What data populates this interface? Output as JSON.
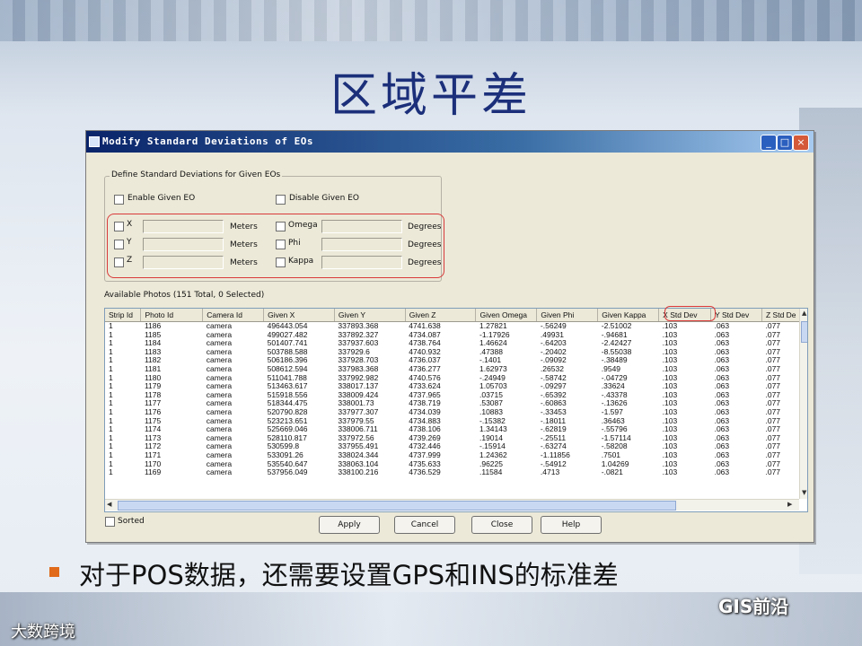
{
  "slide": {
    "title": "区域平差",
    "bullet": "对于POS数据，还需要设置GPS和INS的标准差",
    "watermark_right": "GIS前沿",
    "watermark_left": "大数跨境"
  },
  "dialog": {
    "title": "Modify Standard Deviations of EOs",
    "group_label": "Define Standard Deviations for Given EOs",
    "enable_label": "Enable Given EO",
    "disable_label": "Disable Given EO",
    "pos_fields": [
      {
        "label": "X",
        "unit": "Meters"
      },
      {
        "label": "Y",
        "unit": "Meters"
      },
      {
        "label": "Z",
        "unit": "Meters"
      }
    ],
    "att_fields": [
      {
        "label": "Omega",
        "unit": "Degrees"
      },
      {
        "label": "Phi",
        "unit": "Degrees"
      },
      {
        "label": "Kappa",
        "unit": "Degrees"
      }
    ],
    "available_label": "Available Photos (151 Total, 0 Selected)",
    "sorted_label": "Sorted",
    "buttons": {
      "apply": "Apply",
      "cancel": "Cancel",
      "close": "Close",
      "help": "Help"
    },
    "highlight_color": "#d83a3a",
    "table": {
      "columns": [
        "Strip Id",
        "Photo Id",
        "Camera Id",
        "Given X",
        "Given Y",
        "Given Z",
        "Given Omega",
        "Given Phi",
        "Given Kappa",
        "X Std Dev",
        "Y Std Dev",
        "Z Std De"
      ],
      "rows": [
        [
          "1",
          "1186",
          "camera",
          "496443.054",
          "337893.368",
          "4741.638",
          "1.27821",
          "-.56249",
          "-2.51002",
          ".103",
          ".063",
          ".077"
        ],
        [
          "1",
          "1185",
          "camera",
          "499027.482",
          "337892.327",
          "4734.087",
          "-1.17926",
          ".49931",
          "-.94681",
          ".103",
          ".063",
          ".077"
        ],
        [
          "1",
          "1184",
          "camera",
          "501407.741",
          "337937.603",
          "4738.764",
          "1.46624",
          "-.64203",
          "-2.42427",
          ".103",
          ".063",
          ".077"
        ],
        [
          "1",
          "1183",
          "camera",
          "503788.588",
          "337929.6",
          "4740.932",
          ".47388",
          "-.20402",
          "-8.55038",
          ".103",
          ".063",
          ".077"
        ],
        [
          "1",
          "1182",
          "camera",
          "506186.396",
          "337928.703",
          "4736.037",
          "-.1401",
          "-.09092",
          "-.38489",
          ".103",
          ".063",
          ".077"
        ],
        [
          "1",
          "1181",
          "camera",
          "508612.594",
          "337983.368",
          "4736.277",
          "1.62973",
          ".26532",
          ".9549",
          ".103",
          ".063",
          ".077"
        ],
        [
          "1",
          "1180",
          "camera",
          "511041.788",
          "337992.982",
          "4740.576",
          "-.24949",
          "-.58742",
          "-.04729",
          ".103",
          ".063",
          ".077"
        ],
        [
          "1",
          "1179",
          "camera",
          "513463.617",
          "338017.137",
          "4733.624",
          "1.05703",
          "-.09297",
          ".33624",
          ".103",
          ".063",
          ".077"
        ],
        [
          "1",
          "1178",
          "camera",
          "515918.556",
          "338009.424",
          "4737.965",
          ".03715",
          "-.65392",
          "-.43378",
          ".103",
          ".063",
          ".077"
        ],
        [
          "1",
          "1177",
          "camera",
          "518344.475",
          "338001.73",
          "4738.719",
          ".53087",
          "-.60863",
          "-.13626",
          ".103",
          ".063",
          ".077"
        ],
        [
          "1",
          "1176",
          "camera",
          "520790.828",
          "337977.307",
          "4734.039",
          ".10883",
          "-.33453",
          "-1.597",
          ".103",
          ".063",
          ".077"
        ],
        [
          "1",
          "1175",
          "camera",
          "523213.651",
          "337979.55",
          "4734.883",
          "-.15382",
          "-.18011",
          ".36463",
          ".103",
          ".063",
          ".077"
        ],
        [
          "1",
          "1174",
          "camera",
          "525669.046",
          "338006.711",
          "4738.106",
          "1.34143",
          "-.62819",
          "-.55796",
          ".103",
          ".063",
          ".077"
        ],
        [
          "1",
          "1173",
          "camera",
          "528110.817",
          "337972.56",
          "4739.269",
          ".19014",
          "-.25511",
          "-1.57114",
          ".103",
          ".063",
          ".077"
        ],
        [
          "1",
          "1172",
          "camera",
          "530599.8",
          "337955.491",
          "4732.446",
          "-.15914",
          "-.63274",
          "-.58208",
          ".103",
          ".063",
          ".077"
        ],
        [
          "1",
          "1171",
          "camera",
          "533091.26",
          "338024.344",
          "4737.999",
          "1.24362",
          "-1.11856",
          ".7501",
          ".103",
          ".063",
          ".077"
        ],
        [
          "1",
          "1170",
          "camera",
          "535540.647",
          "338063.104",
          "4735.633",
          ".96225",
          "-.54912",
          "1.04269",
          ".103",
          ".063",
          ".077"
        ],
        [
          "1",
          "1169",
          "camera",
          "537956.049",
          "338100.216",
          "4736.529",
          ".11584",
          ".4713",
          "-.0821",
          ".103",
          ".063",
          ".077"
        ]
      ]
    }
  }
}
